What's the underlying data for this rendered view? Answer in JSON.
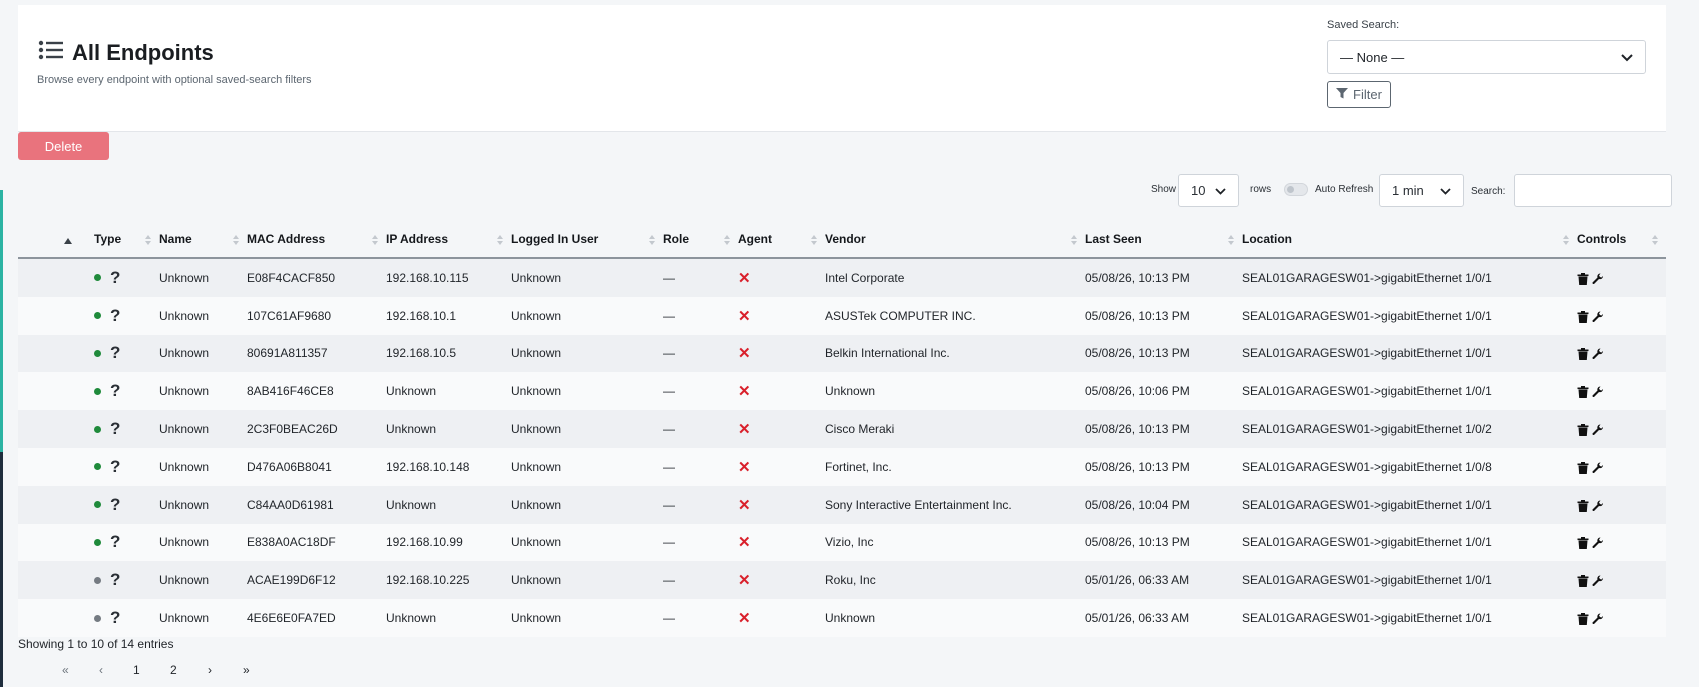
{
  "header": {
    "title": "All Endpoints",
    "subtitle": "Browse every endpoint with optional saved-search filters"
  },
  "saved_search": {
    "label": "Saved Search:",
    "selected": "— None —",
    "filter_label": "Filter"
  },
  "actions": {
    "delete_label": "Delete"
  },
  "table_controls": {
    "show_label": "Show",
    "rows_value": "10",
    "rows_label": "rows",
    "auto_refresh_label": "Auto Refresh",
    "refresh_value": "1 min",
    "search_label": "Search:",
    "search_value": ""
  },
  "columns": [
    "Type",
    "Name",
    "MAC Address",
    "IP Address",
    "Logged In User",
    "Role",
    "Agent",
    "Vendor",
    "Last Seen",
    "Location",
    "Controls"
  ],
  "rows": [
    {
      "status_color": "#1f8a3b",
      "type": "?",
      "name": "Unknown",
      "mac": "E08F4CACF850",
      "ip": "192.168.10.115",
      "user": "Unknown",
      "role": "—",
      "agent": "✕",
      "vendor": "Intel Corporate",
      "last_seen": "05/08/26, 10:13 PM",
      "location": "SEAL01GARAGESW01->gigabitEthernet 1/0/1"
    },
    {
      "status_color": "#1f8a3b",
      "type": "?",
      "name": "Unknown",
      "mac": "107C61AF9680",
      "ip": "192.168.10.1",
      "user": "Unknown",
      "role": "—",
      "agent": "✕",
      "vendor": "ASUSTek COMPUTER INC.",
      "last_seen": "05/08/26, 10:13 PM",
      "location": "SEAL01GARAGESW01->gigabitEthernet 1/0/1"
    },
    {
      "status_color": "#1f8a3b",
      "type": "?",
      "name": "Unknown",
      "mac": "80691A811357",
      "ip": "192.168.10.5",
      "user": "Unknown",
      "role": "—",
      "agent": "✕",
      "vendor": "Belkin International Inc.",
      "last_seen": "05/08/26, 10:13 PM",
      "location": "SEAL01GARAGESW01->gigabitEthernet 1/0/1"
    },
    {
      "status_color": "#1f8a3b",
      "type": "?",
      "name": "Unknown",
      "mac": "8AB416F46CE8",
      "ip": "Unknown",
      "user": "Unknown",
      "role": "—",
      "agent": "✕",
      "vendor": "Unknown",
      "last_seen": "05/08/26, 10:06 PM",
      "location": "SEAL01GARAGESW01->gigabitEthernet 1/0/1"
    },
    {
      "status_color": "#1f8a3b",
      "type": "?",
      "name": "Unknown",
      "mac": "2C3F0BEAC26D",
      "ip": "Unknown",
      "user": "Unknown",
      "role": "—",
      "agent": "✕",
      "vendor": "Cisco Meraki",
      "last_seen": "05/08/26, 10:13 PM",
      "location": "SEAL01GARAGESW01->gigabitEthernet 1/0/2"
    },
    {
      "status_color": "#1f8a3b",
      "type": "?",
      "name": "Unknown",
      "mac": "D476A06B8041",
      "ip": "192.168.10.148",
      "user": "Unknown",
      "role": "—",
      "agent": "✕",
      "vendor": "Fortinet, Inc.",
      "last_seen": "05/08/26, 10:13 PM",
      "location": "SEAL01GARAGESW01->gigabitEthernet 1/0/8"
    },
    {
      "status_color": "#1f8a3b",
      "type": "?",
      "name": "Unknown",
      "mac": "C84AA0D61981",
      "ip": "Unknown",
      "user": "Unknown",
      "role": "—",
      "agent": "✕",
      "vendor": "Sony Interactive Entertainment Inc.",
      "last_seen": "05/08/26, 10:04 PM",
      "location": "SEAL01GARAGESW01->gigabitEthernet 1/0/1"
    },
    {
      "status_color": "#1f8a3b",
      "type": "?",
      "name": "Unknown",
      "mac": "E838A0AC18DF",
      "ip": "192.168.10.99",
      "user": "Unknown",
      "role": "—",
      "agent": "✕",
      "vendor": "Vizio, Inc",
      "last_seen": "05/08/26, 10:13 PM",
      "location": "SEAL01GARAGESW01->gigabitEthernet 1/0/1"
    },
    {
      "status_color": "#757b82",
      "type": "?",
      "name": "Unknown",
      "mac": "ACAE199D6F12",
      "ip": "192.168.10.225",
      "user": "Unknown",
      "role": "—",
      "agent": "✕",
      "vendor": "Roku, Inc",
      "last_seen": "05/01/26, 06:33 AM",
      "location": "SEAL01GARAGESW01->gigabitEthernet 1/0/1"
    },
    {
      "status_color": "#757b82",
      "type": "?",
      "name": "Unknown",
      "mac": "4E6E6E0FA7ED",
      "ip": "Unknown",
      "user": "Unknown",
      "role": "—",
      "agent": "✕",
      "vendor": "Unknown",
      "last_seen": "05/01/26, 06:33 AM",
      "location": "SEAL01GARAGESW01->gigabitEthernet 1/0/1"
    }
  ],
  "footer": {
    "showing_text": "Showing 1 to 10 of 14 entries",
    "pager": {
      "first": "«",
      "prev": "‹",
      "page1": "1",
      "page2": "2",
      "next": "›",
      "last": "»"
    }
  },
  "colors": {
    "accent_teal": "#2bb3a3",
    "delete_bg": "#e9737d",
    "agent_x": "#d9202b"
  }
}
